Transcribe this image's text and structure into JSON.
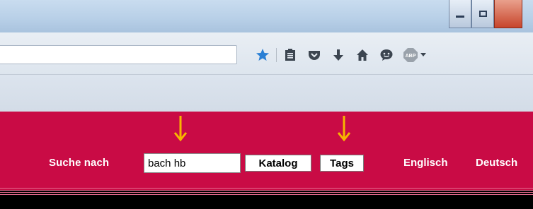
{
  "window": {
    "buttons": [
      {
        "name": "minimize-button",
        "glyph": "—"
      },
      {
        "name": "maximize-button",
        "glyph": "❐"
      }
    ]
  },
  "toolbar": {
    "url_value": "",
    "icons": [
      "bookmark-star-icon",
      "reading-list-icon",
      "pocket-icon",
      "download-icon",
      "home-icon",
      "chat-icon",
      "adblock-plus-icon"
    ],
    "abp_label": "ABP",
    "accent_star": "#2a7fd4"
  },
  "site": {
    "background": "#c90b45",
    "search_label": "Suche nach",
    "search_value": "bach hb",
    "catalog_button": "Katalog",
    "tags_button": "Tags",
    "lang_english": "Englisch",
    "lang_german": "Deutsch"
  },
  "annotations": {
    "arrow_color": "#f6b600"
  }
}
